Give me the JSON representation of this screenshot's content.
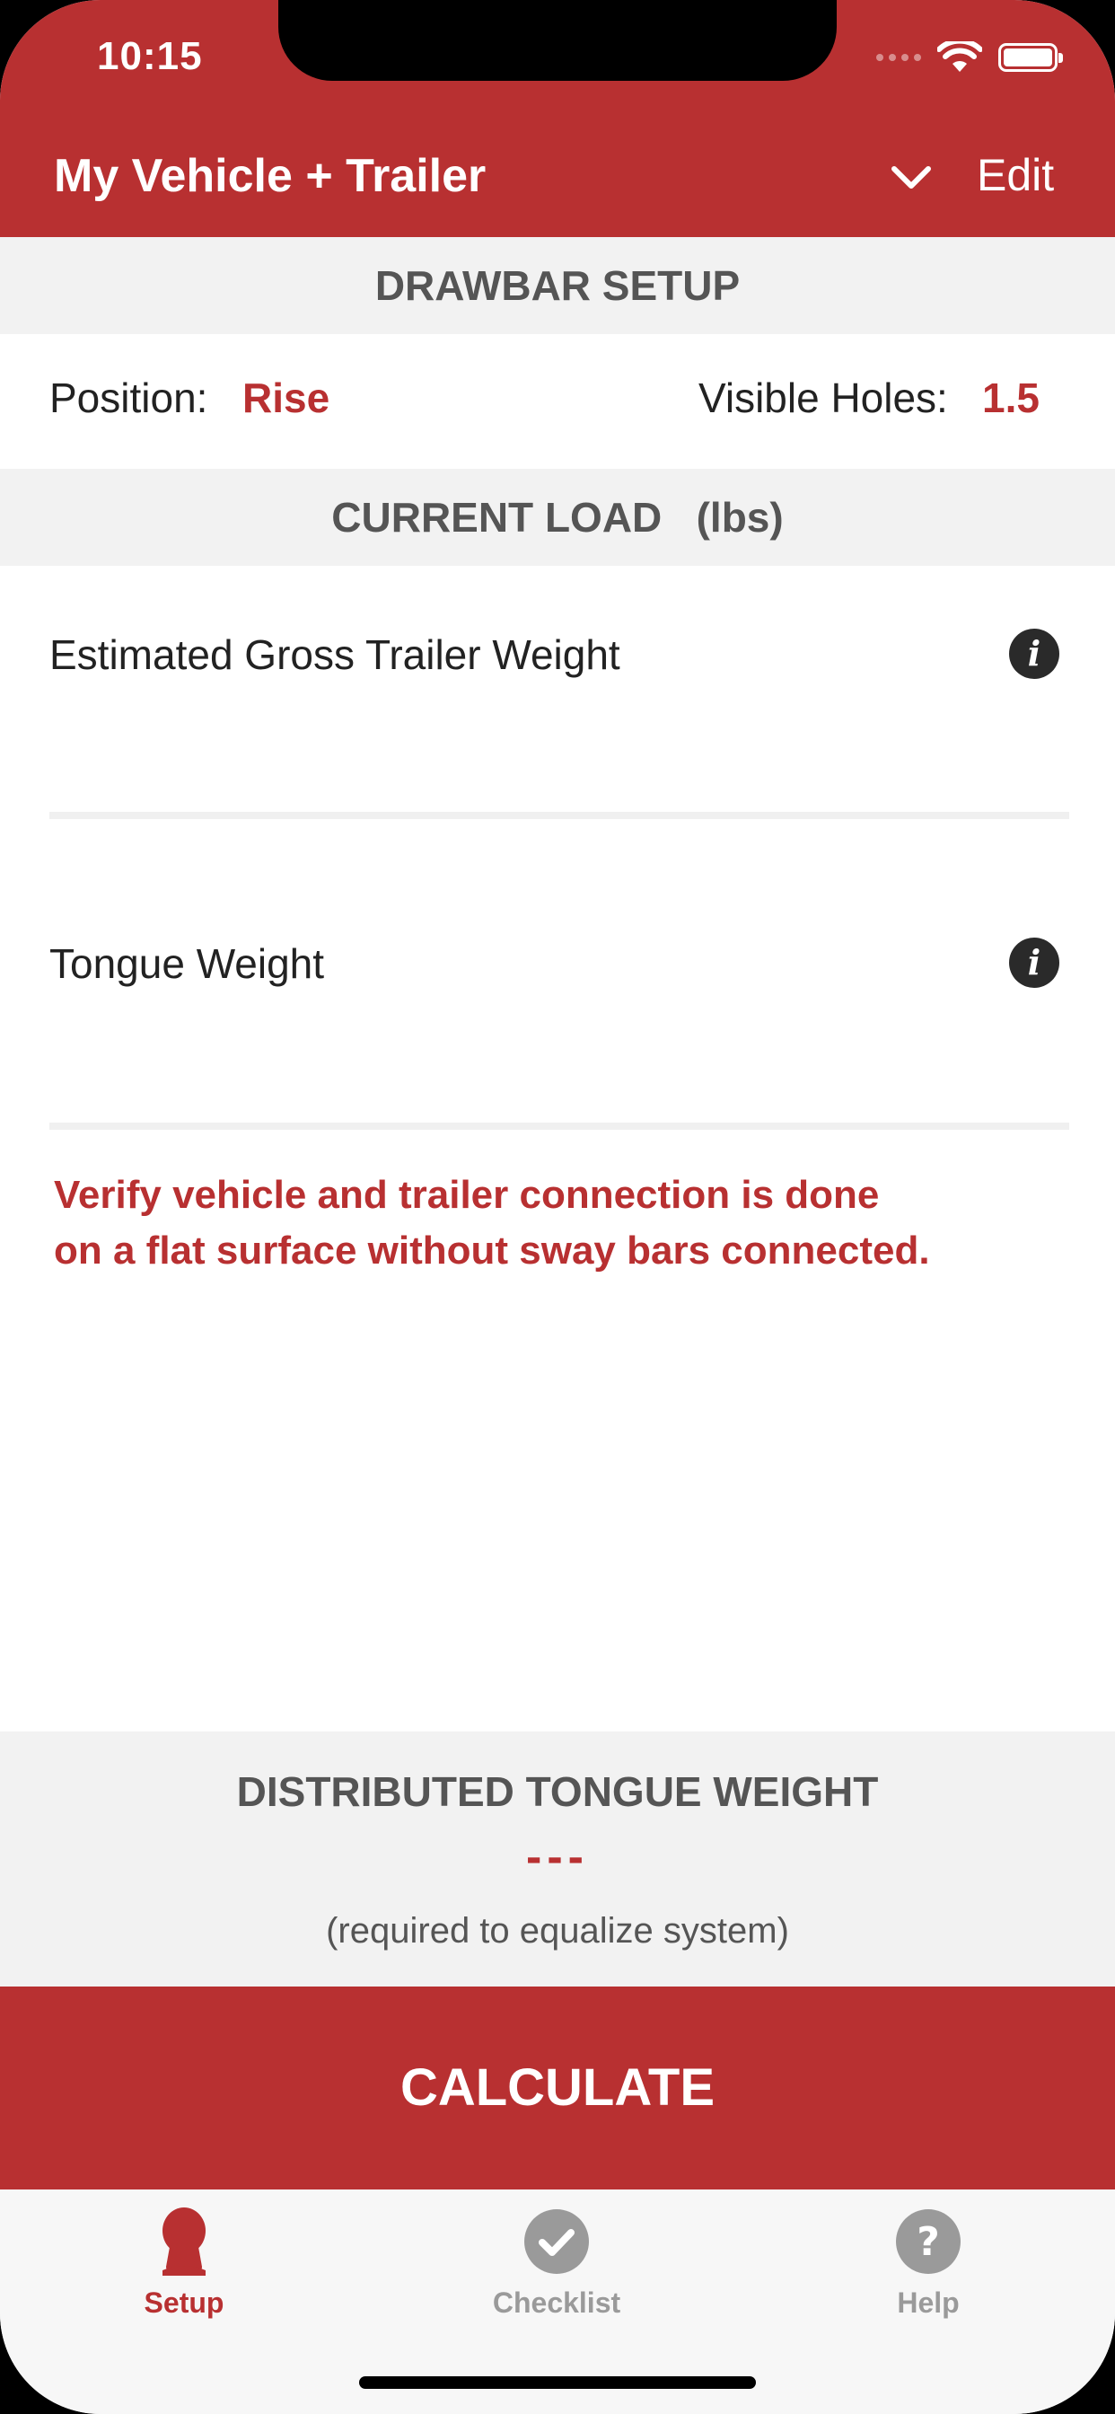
{
  "status_bar": {
    "time": "10:15"
  },
  "nav": {
    "title": "My Vehicle + Trailer",
    "edit_label": "Edit"
  },
  "drawbar": {
    "header": "DRAWBAR SETUP",
    "position_label": "Position:",
    "position_value": "Rise",
    "holes_label": "Visible Holes:",
    "holes_value": "1.5"
  },
  "load": {
    "header": "CURRENT LOAD   (lbs)",
    "gross_label": "Estimated Gross Trailer Weight",
    "tongue_label": "Tongue Weight",
    "warning_line1": "Verify vehicle and trailer connection is done",
    "warning_line2": "on a flat surface without sway bars connected."
  },
  "result": {
    "title": "DISTRIBUTED TONGUE WEIGHT",
    "value": "---",
    "note": "(required to equalize system)"
  },
  "calculate_label": "CALCULATE",
  "tabs": [
    {
      "label": "Setup",
      "icon": "person-icon",
      "active": true
    },
    {
      "label": "Checklist",
      "icon": "check-circle-icon",
      "active": false
    },
    {
      "label": "Help",
      "icon": "question-circle-icon",
      "active": false
    }
  ],
  "colors": {
    "accent": "#b83031",
    "inactive": "#9a9a9a",
    "section_bg": "#f2f2f2"
  }
}
